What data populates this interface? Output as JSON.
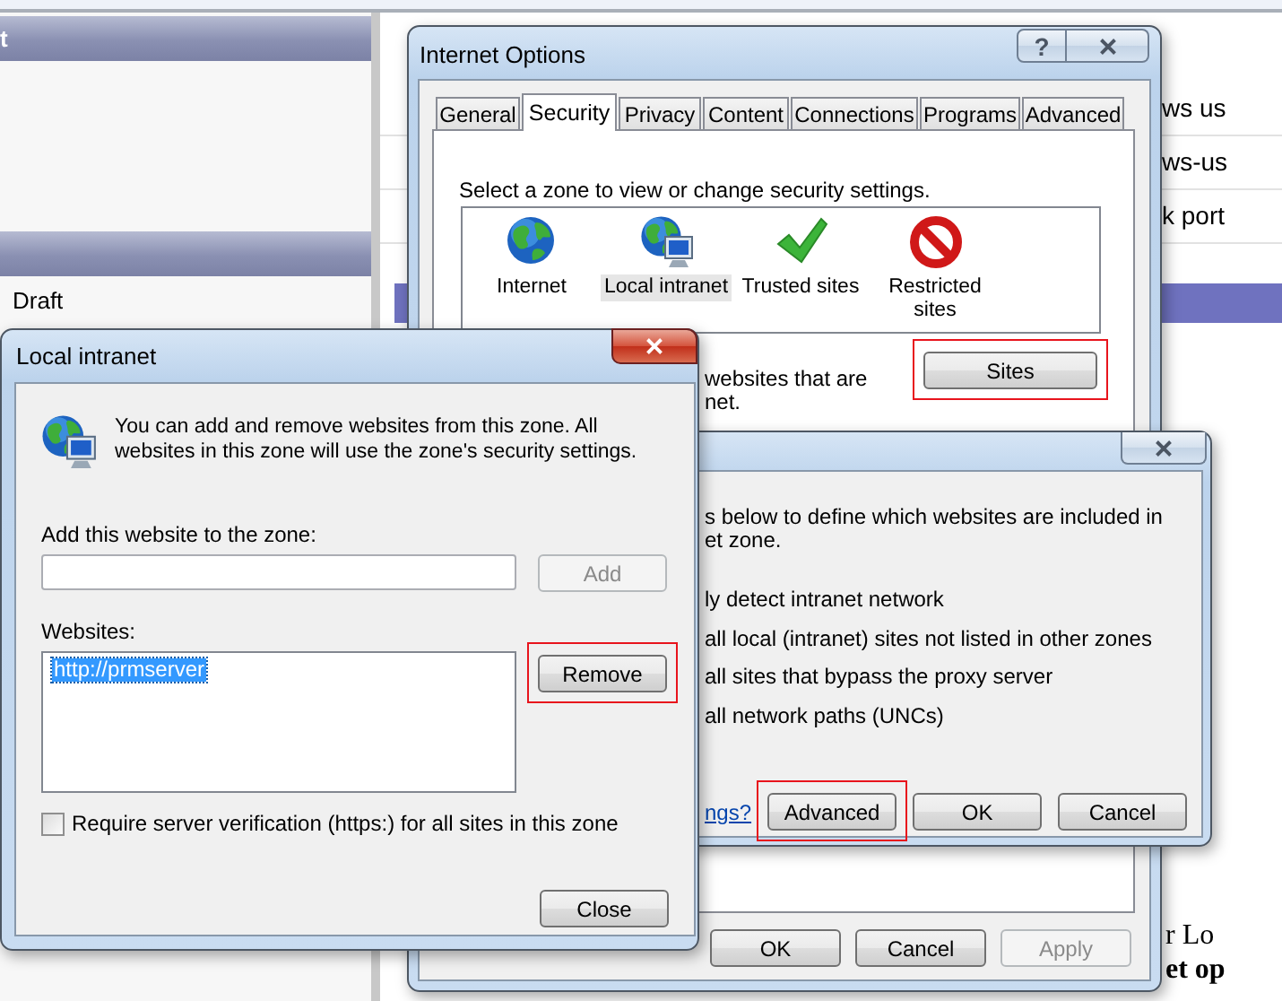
{
  "background": {
    "header_title": "t",
    "sidebar_items": [
      "Draft"
    ],
    "document_lines": [
      "ws us",
      "ws-us",
      "k port"
    ],
    "footer_lines": [
      {
        "text": "r Lo",
        "bold": false
      },
      {
        "text": "et op",
        "bold": true
      }
    ]
  },
  "internet_options": {
    "title": "Internet Options",
    "help_button": "?",
    "tabs": [
      {
        "label": "General",
        "selected": false
      },
      {
        "label": "Security",
        "selected": true
      },
      {
        "label": "Privacy",
        "selected": false
      },
      {
        "label": "Content",
        "selected": false
      },
      {
        "label": "Connections",
        "selected": false
      },
      {
        "label": "Programs",
        "selected": false
      },
      {
        "label": "Advanced",
        "selected": false
      }
    ],
    "zone_prompt": "Select a zone to view or change security settings.",
    "zones": [
      {
        "label": "Internet",
        "kind": "internet",
        "selected": false
      },
      {
        "label": "Local intranet",
        "kind": "intranet",
        "selected": true
      },
      {
        "label": "Trusted sites",
        "kind": "trusted",
        "selected": false
      },
      {
        "label": "Restricted sites",
        "kind": "restricted",
        "selected": false
      }
    ],
    "zone_description": [
      "websites that are",
      "net."
    ],
    "sites_button": {
      "label": "Sites",
      "highlighted": true
    },
    "buttons": [
      {
        "label": "OK",
        "disabled": false
      },
      {
        "label": "Cancel",
        "disabled": false
      },
      {
        "label": "Apply",
        "disabled": true
      }
    ]
  },
  "intranet_settings": {
    "intro": [
      "s below to define which websites are included in",
      "et zone."
    ],
    "options": [
      "ly detect intranet network",
      "all local (intranet) sites not listed in other zones",
      "all sites that bypass the proxy server",
      "all network paths (UNCs)"
    ],
    "help_link": "ngs?",
    "buttons": [
      {
        "label": "Advanced",
        "highlighted": true
      },
      {
        "label": "OK",
        "highlighted": false
      },
      {
        "label": "Cancel",
        "highlighted": false
      }
    ]
  },
  "local_intranet": {
    "title": "Local intranet",
    "message": "You can add and remove websites from this zone. All websites in this zone will use the zone's security settings.",
    "add_label": "Add this website to the zone:",
    "add_button": {
      "label": "Add",
      "disabled": true
    },
    "websites_label": "Websites:",
    "websites": [
      {
        "text": "http://prmserver",
        "selected": true
      }
    ],
    "remove_button": {
      "label": "Remove",
      "highlighted": true
    },
    "require_https": {
      "label": "Require server verification (https:) for all sites in this zone",
      "checked": false
    },
    "close_button": {
      "label": "Close"
    }
  }
}
